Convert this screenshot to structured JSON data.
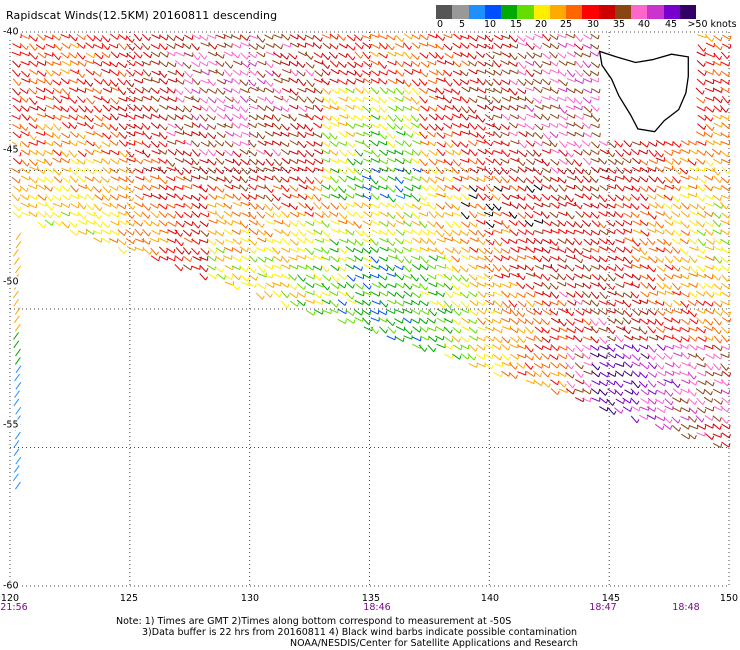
{
  "title": "Rapidscat Winds(12.5KM) 20160811 descending",
  "colorbar": {
    "colors": [
      "#555555",
      "#999999",
      "#1e8fff",
      "#0050ff",
      "#00aa00",
      "#66dd00",
      "#ffee00",
      "#ffaa00",
      "#ff6600",
      "#ff0000",
      "#cc0000",
      "#8b4513",
      "#ff66cc",
      "#cc33cc",
      "#7700cc",
      "#330066"
    ],
    "tick_labels": [
      "0",
      "5",
      "10",
      "15",
      "20",
      "25",
      "30",
      "35",
      "40",
      "45",
      ">50 knots"
    ]
  },
  "map": {
    "lat_labels": [
      "-40",
      "-45",
      "-50",
      "-55",
      "-60"
    ],
    "lon_labels": [
      "120",
      "125",
      "130",
      "135",
      "140",
      "145",
      "150"
    ],
    "time_labels": [
      "21:56",
      "18:46",
      "18:47",
      "18:48"
    ],
    "lat_range": [
      -60,
      -40
    ],
    "lon_range": [
      120,
      150
    ],
    "landmass": "Tasmania",
    "grid": "dotted"
  },
  "notes": {
    "line1": "Note: 1) Times are GMT 2)Times along bottom correspond to measurement at -50S",
    "line2": "3)Data buffer is 22 hrs from 20160811 4) Black wind barbs indicate possible contamination",
    "line3": "NOAA/NESDIS/Center for Satellite Applications and Research"
  }
}
